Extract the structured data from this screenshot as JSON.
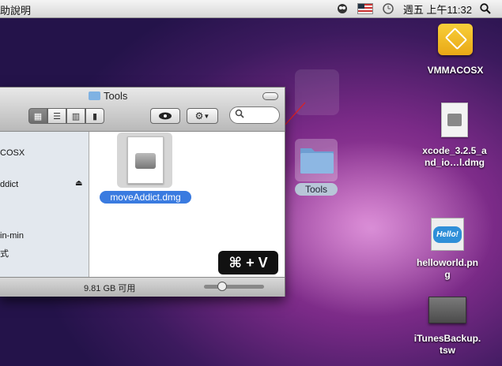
{
  "menubar": {
    "app_menu": "助說明",
    "clock": "週五 上午11:32"
  },
  "desktop": {
    "icons": [
      {
        "label_1": "VMMACOSX",
        "label_2": ""
      },
      {
        "label_1": "xcode_3.2.5_a",
        "label_2": "nd_io…l.dmg"
      },
      {
        "label_1": "helloworld.pn",
        "label_2": "g"
      },
      {
        "label_1": "iTunesBackup.",
        "label_2": "tsw"
      }
    ],
    "hello_badge": "Hello!",
    "tools_folder_label": "Tools"
  },
  "finder": {
    "title": "Tools",
    "sidebar_items": [
      "COSX",
      "ddict",
      "in-min",
      "式"
    ],
    "file_label": "moveAddict.dmg",
    "status_free": "9.81 GB 可用",
    "shortcut_hint": "⌘ + V"
  }
}
